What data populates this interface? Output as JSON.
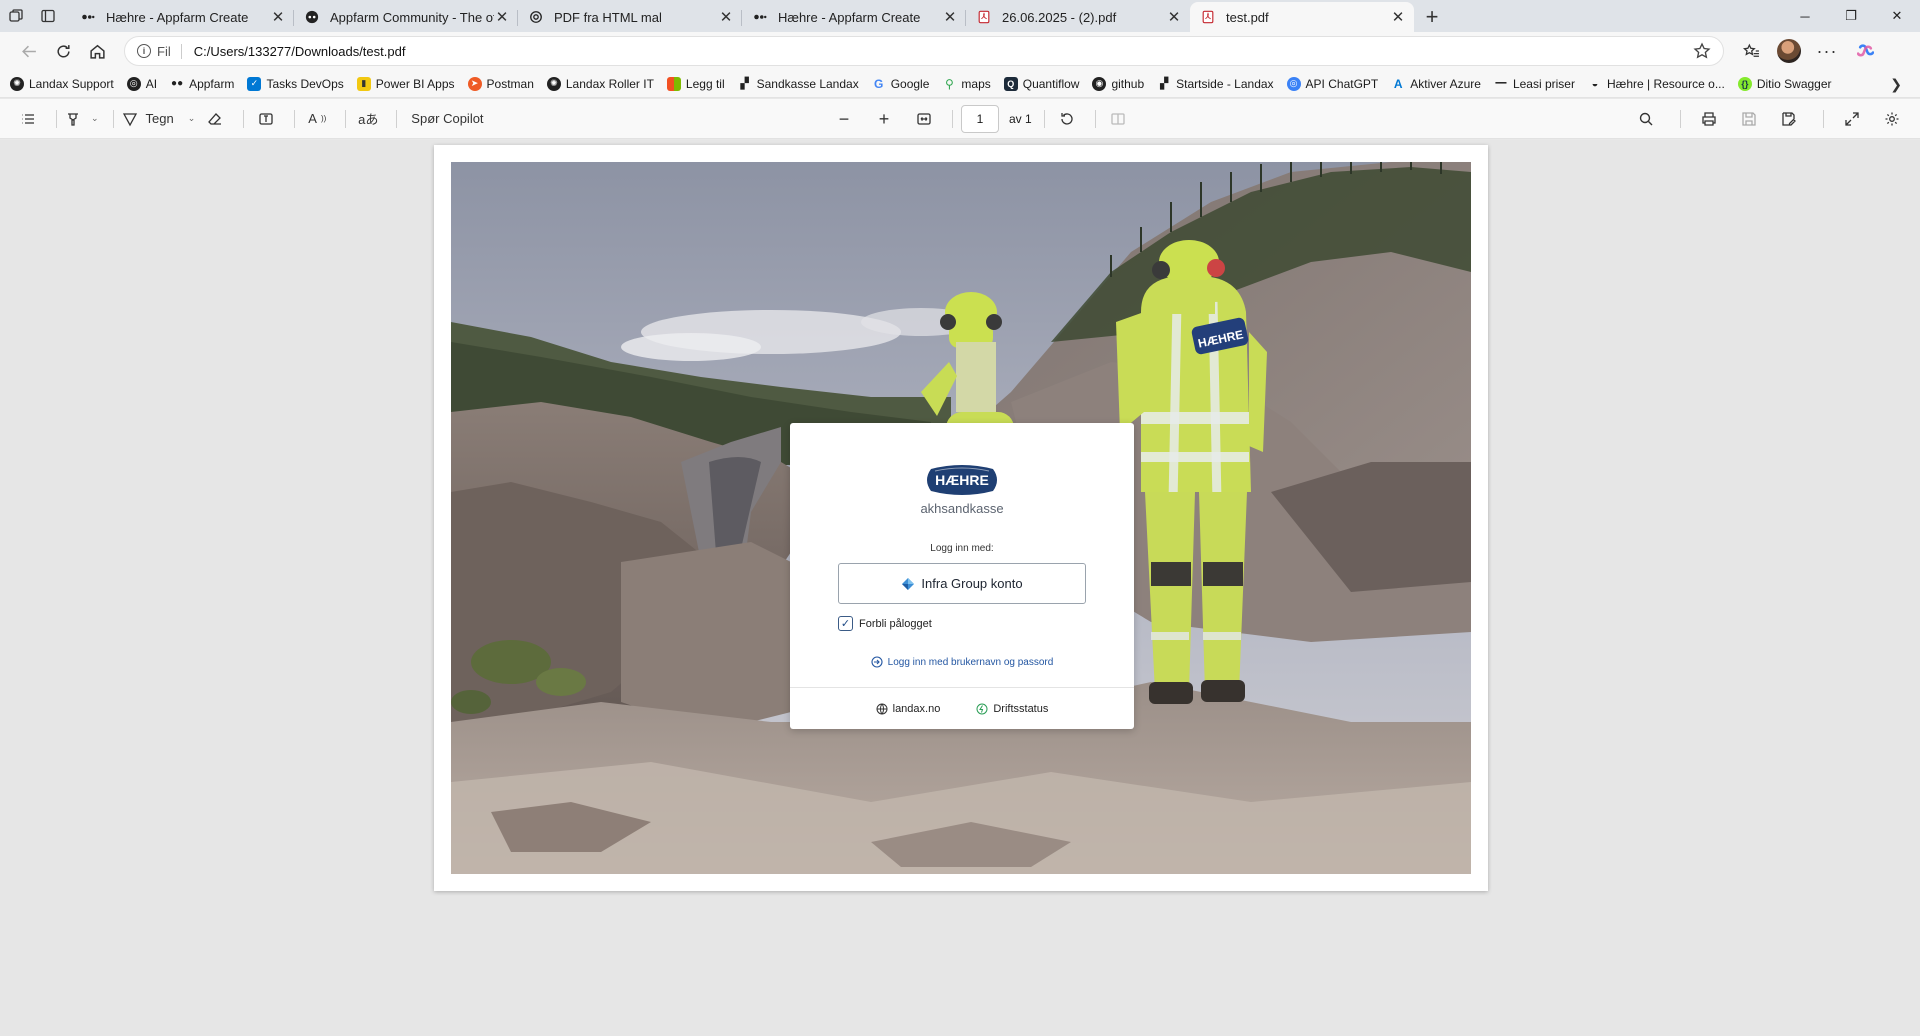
{
  "browser": {
    "tabs": [
      {
        "title": "Hæhre - Appfarm Create",
        "active": false,
        "icon": "appfarm-icon"
      },
      {
        "title": "Appfarm Community - The officia",
        "active": false,
        "icon": "appfarm-community-icon"
      },
      {
        "title": "PDF fra HTML mal",
        "active": false,
        "icon": "chatgpt-icon"
      },
      {
        "title": "Hæhre - Appfarm Create",
        "active": false,
        "icon": "appfarm-icon"
      },
      {
        "title": "26.06.2025 - (2).pdf",
        "active": false,
        "icon": "pdf-icon"
      },
      {
        "title": "test.pdf",
        "active": true,
        "icon": "pdf-icon"
      }
    ],
    "address": {
      "scheme_label": "Fil",
      "url": "C:/Users/133277/Downloads/test.pdf"
    },
    "bookmarks": [
      {
        "label": "Landax Support",
        "icon": "landax-icon",
        "color": "#1b1b1b"
      },
      {
        "label": "AI",
        "icon": "chatgpt-icon",
        "color": "#1b1b1b"
      },
      {
        "label": "Appfarm",
        "icon": "appfarm-icon",
        "color": "#1b1b1b"
      },
      {
        "label": "Tasks DevOps",
        "icon": "devops-icon",
        "color": "#0078d4"
      },
      {
        "label": "Power BI Apps",
        "icon": "powerbi-icon",
        "color": "#f2c811"
      },
      {
        "label": "Postman",
        "icon": "postman-icon",
        "color": "#ef5b25"
      },
      {
        "label": "Landax Roller IT",
        "icon": "landax-icon",
        "color": "#1b1b1b"
      },
      {
        "label": "Legg til",
        "icon": "microsoft-icon",
        "color": "#f25022"
      },
      {
        "label": "Sandkasse Landax",
        "icon": "landax-blocks-icon",
        "color": "#1b1b1b"
      },
      {
        "label": "Google",
        "icon": "google-icon",
        "color": "#4285f4"
      },
      {
        "label": "maps",
        "icon": "maps-icon",
        "color": "#34a853"
      },
      {
        "label": "Quantiflow",
        "icon": "quantiflow-icon",
        "color": "#1b1b1b"
      },
      {
        "label": "github",
        "icon": "github-icon",
        "color": "#1b1b1b"
      },
      {
        "label": "Startside - Landax",
        "icon": "landax-blocks-icon",
        "color": "#1b1b1b"
      },
      {
        "label": "API ChatGPT",
        "icon": "api-icon",
        "color": "#3b82f6"
      },
      {
        "label": "Aktiver Azure",
        "icon": "azure-icon",
        "color": "#0078d4"
      },
      {
        "label": "Leasi priser",
        "icon": "leasi-icon",
        "color": "#1b1b1b"
      },
      {
        "label": "Hæhre | Resource o...",
        "icon": "haehre-icon",
        "color": "#1b1b1b"
      },
      {
        "label": "Ditio Swagger",
        "icon": "swagger-icon",
        "color": "#85ea2d"
      }
    ]
  },
  "pdf_toolbar": {
    "draw_label": "Tegn",
    "copilot_label": "Spør Copilot",
    "page_current": "1",
    "page_of": "av 1"
  },
  "login_card": {
    "logo_text": "HÆHRE",
    "subtitle": "akhsandkasse",
    "login_with": "Logg inn med:",
    "sso_button": "Infra Group konto",
    "stay_logged_in": "Forbli pålogget",
    "stay_checked": true,
    "password_link": "Logg inn med brukernavn og passord",
    "footer_link_site": "landax.no",
    "footer_link_status": "Driftsstatus",
    "brand_color": "#1f3f73"
  }
}
